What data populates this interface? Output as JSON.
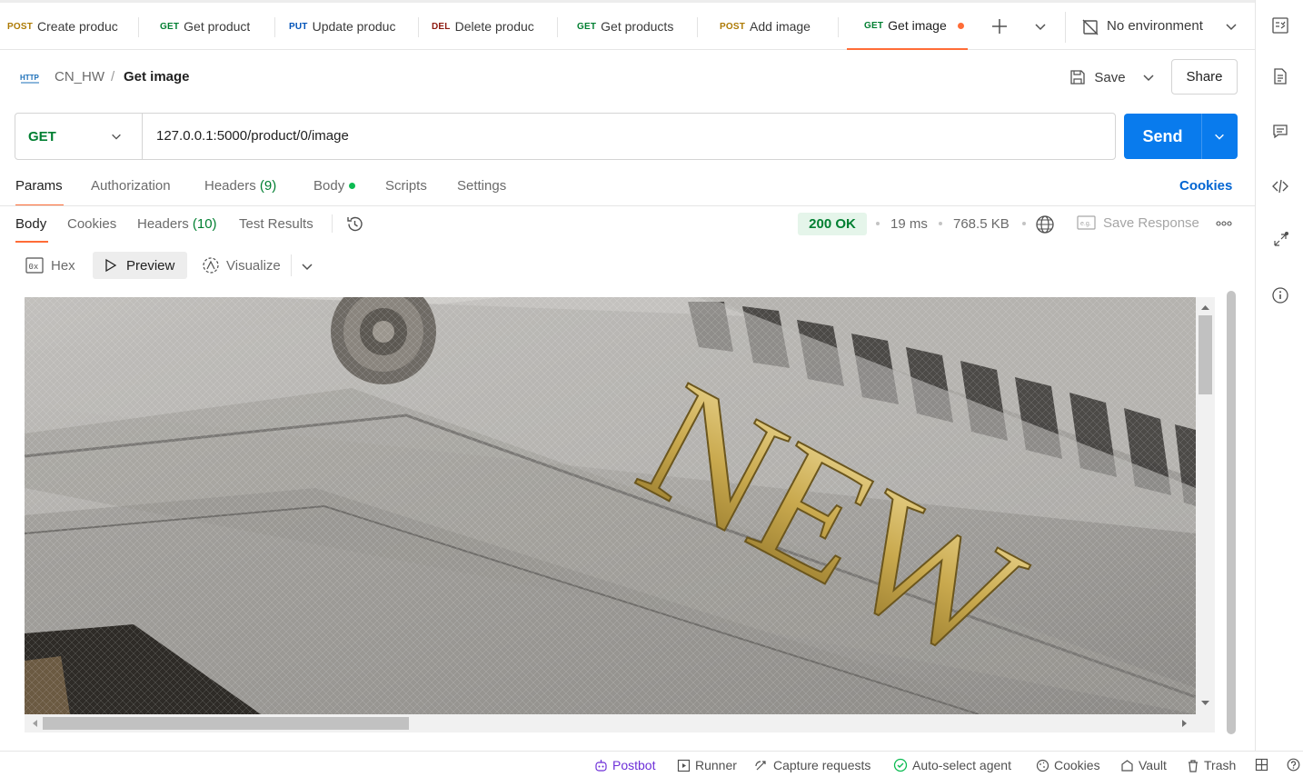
{
  "tabs": [
    {
      "method": "POST",
      "name": "Create produc"
    },
    {
      "method": "GET",
      "name": "Get product"
    },
    {
      "method": "PUT",
      "name": "Update produc"
    },
    {
      "method": "DEL",
      "name": "Delete produc"
    },
    {
      "method": "GET",
      "name": "Get products"
    },
    {
      "method": "POST",
      "name": "Add image"
    },
    {
      "method": "GET",
      "name": "Get image"
    }
  ],
  "environment": "No environment",
  "breadcrumb": {
    "collection": "CN_HW",
    "separator": "/",
    "request": "Get image",
    "badge": "HTTP"
  },
  "header": {
    "save": "Save",
    "share": "Share"
  },
  "request": {
    "method": "GET",
    "url": "127.0.0.1:5000/product/0/image",
    "send": "Send"
  },
  "request_tabs": {
    "params": "Params",
    "authorization": "Authorization",
    "headers": "Headers",
    "headers_count": "(9)",
    "body": "Body",
    "scripts": "Scripts",
    "settings": "Settings",
    "cookies": "Cookies"
  },
  "response_tabs": {
    "body": "Body",
    "cookies": "Cookies",
    "headers": "Headers",
    "headers_count": "(10)",
    "test_results": "Test Results"
  },
  "response_meta": {
    "status": "200 OK",
    "time": "19 ms",
    "size": "768.5 KB",
    "save_response": "Save Response"
  },
  "view_modes": {
    "hex_icon": "0x",
    "hex": "Hex",
    "preview": "Preview",
    "visualize": "Visualize"
  },
  "image": {
    "engraved_text": "NEW",
    "horizontal_scroll": 0.0,
    "vertical_scroll": 0.0
  },
  "footer": {
    "postbot": "Postbot",
    "runner": "Runner",
    "capture": "Capture requests",
    "agent": "Auto-select agent",
    "cookies": "Cookies",
    "vault": "Vault",
    "trash": "Trash"
  },
  "colors": {
    "accent": "#ff6c37",
    "send": "#097bed",
    "get": "#007f31",
    "post": "#ad7a03",
    "put": "#0053b8",
    "del": "#8e1a10"
  }
}
